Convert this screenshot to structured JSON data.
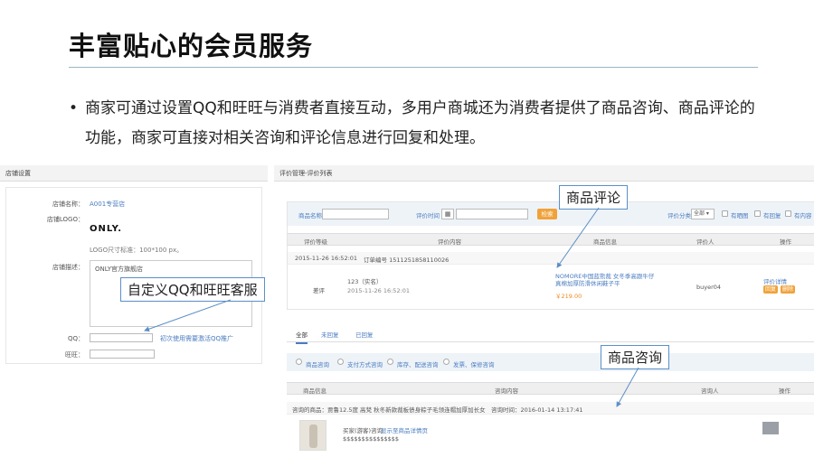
{
  "slide": {
    "title": "丰富贴心的会员服务",
    "bullet_mark": "•",
    "bullet": "商家可通过设置QQ和旺旺与消费者直接互动，多用户商城还为消费者提供了商品咨询、商品评论的功能，商家可直接对相关咨询和评论信息进行回复和处理。"
  },
  "shop_settings": {
    "header": "店铺设置",
    "name_label": "店铺名称：",
    "name_value": "A001专营店",
    "logo_label": "店铺LOGO：",
    "logo_text": "ONLY.",
    "logo_hint": "LOGO尺寸标准：100*100 px。",
    "desc_label": "店铺描述：",
    "desc_value": "ONLY官方旗舰店",
    "qq_label": "QQ：",
    "qq_hint": "初次使用需要激活QQ推广",
    "ww_label": "旺旺："
  },
  "reviews": {
    "header": "评价管理-评价列表",
    "filter": {
      "product_label": "商品名称",
      "time_label": "评价时间",
      "date_icon": "calendar-icon",
      "search_button": "检索",
      "category_label": "评价分类",
      "category_value": "全部",
      "opt1": "有晒图",
      "opt2": "有回复",
      "opt3": "有内容"
    },
    "columns": [
      "评价等级",
      "评价内容",
      "商品信息",
      "评价人",
      "操作"
    ],
    "order": {
      "time": "2015-11-26 16:52:01",
      "order_no": "订单编号 1511251858110026"
    },
    "row": {
      "grade": "差评",
      "content": "123（实名）",
      "content_time": "2015-11-26 16:52:01",
      "product": "NOMORE中国蓝熊裁 女冬季高跟牛仔真棉加厚防滑休闲鞋子平",
      "price": "￥219.00",
      "reviewer": "buyer04",
      "op_link": "评价详情",
      "btn1": "回复",
      "btn2": "删除"
    }
  },
  "consult": {
    "tabs": [
      "全部",
      "未回复",
      "已回复"
    ],
    "radios": [
      "商品咨询",
      "支付方式咨询",
      "库存、配送咨询",
      "发票、保修咨询"
    ],
    "columns": [
      "商品信息",
      "咨询内容",
      "咨询人",
      "操作"
    ],
    "info_line": "咨询的商品：贾鲁12.5度 高梵 秋冬新款裁板债身粽子毛领连帽加厚加长女",
    "info_time": "咨询时间：2016-01-14 13:17:41",
    "buyer_line": "买家(游客)咨询",
    "buyer_link": "显示至商品详情页",
    "question": "$$$$$$$$$$$$$$$"
  },
  "callouts": {
    "qq": "自定义QQ和旺旺客服",
    "review": "商品评论",
    "consult": "商品咨询"
  },
  "colors": {
    "accent_blue": "#4a7cc0",
    "orange": "#f0a23a",
    "callout_border": "#5b8fc7"
  }
}
